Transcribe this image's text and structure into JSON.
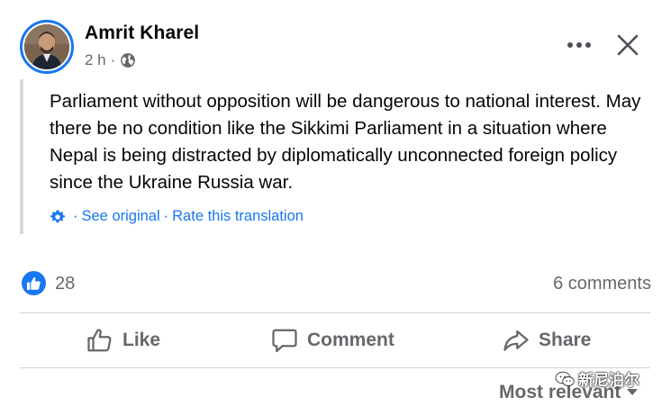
{
  "post": {
    "author": "Amrit Kharel",
    "time": "2 h",
    "dot": "·",
    "privacy_icon": "globe-icon",
    "text": "Parliament without opposition will be dangerous to national interest. May there be no condition like the Sikkimi Parliament in a situation where Nepal is being distracted by diplomatically unconnected foreign policy since the Ukraine Russia war.",
    "translation": {
      "icon": "gear-icon",
      "dot": "·",
      "see_original": "See original",
      "rate": "Rate this translation"
    }
  },
  "reactions": {
    "icon": "like-icon",
    "count": "28",
    "comments": "6 comments"
  },
  "actions": {
    "like": "Like",
    "comment": "Comment",
    "share": "Share"
  },
  "sort": {
    "label": "Most relevant"
  },
  "watermark": {
    "text": "新尼泊尔"
  },
  "colors": {
    "accent": "#1877f2",
    "secondary_text": "#65676b",
    "divider": "#ced0d4"
  }
}
